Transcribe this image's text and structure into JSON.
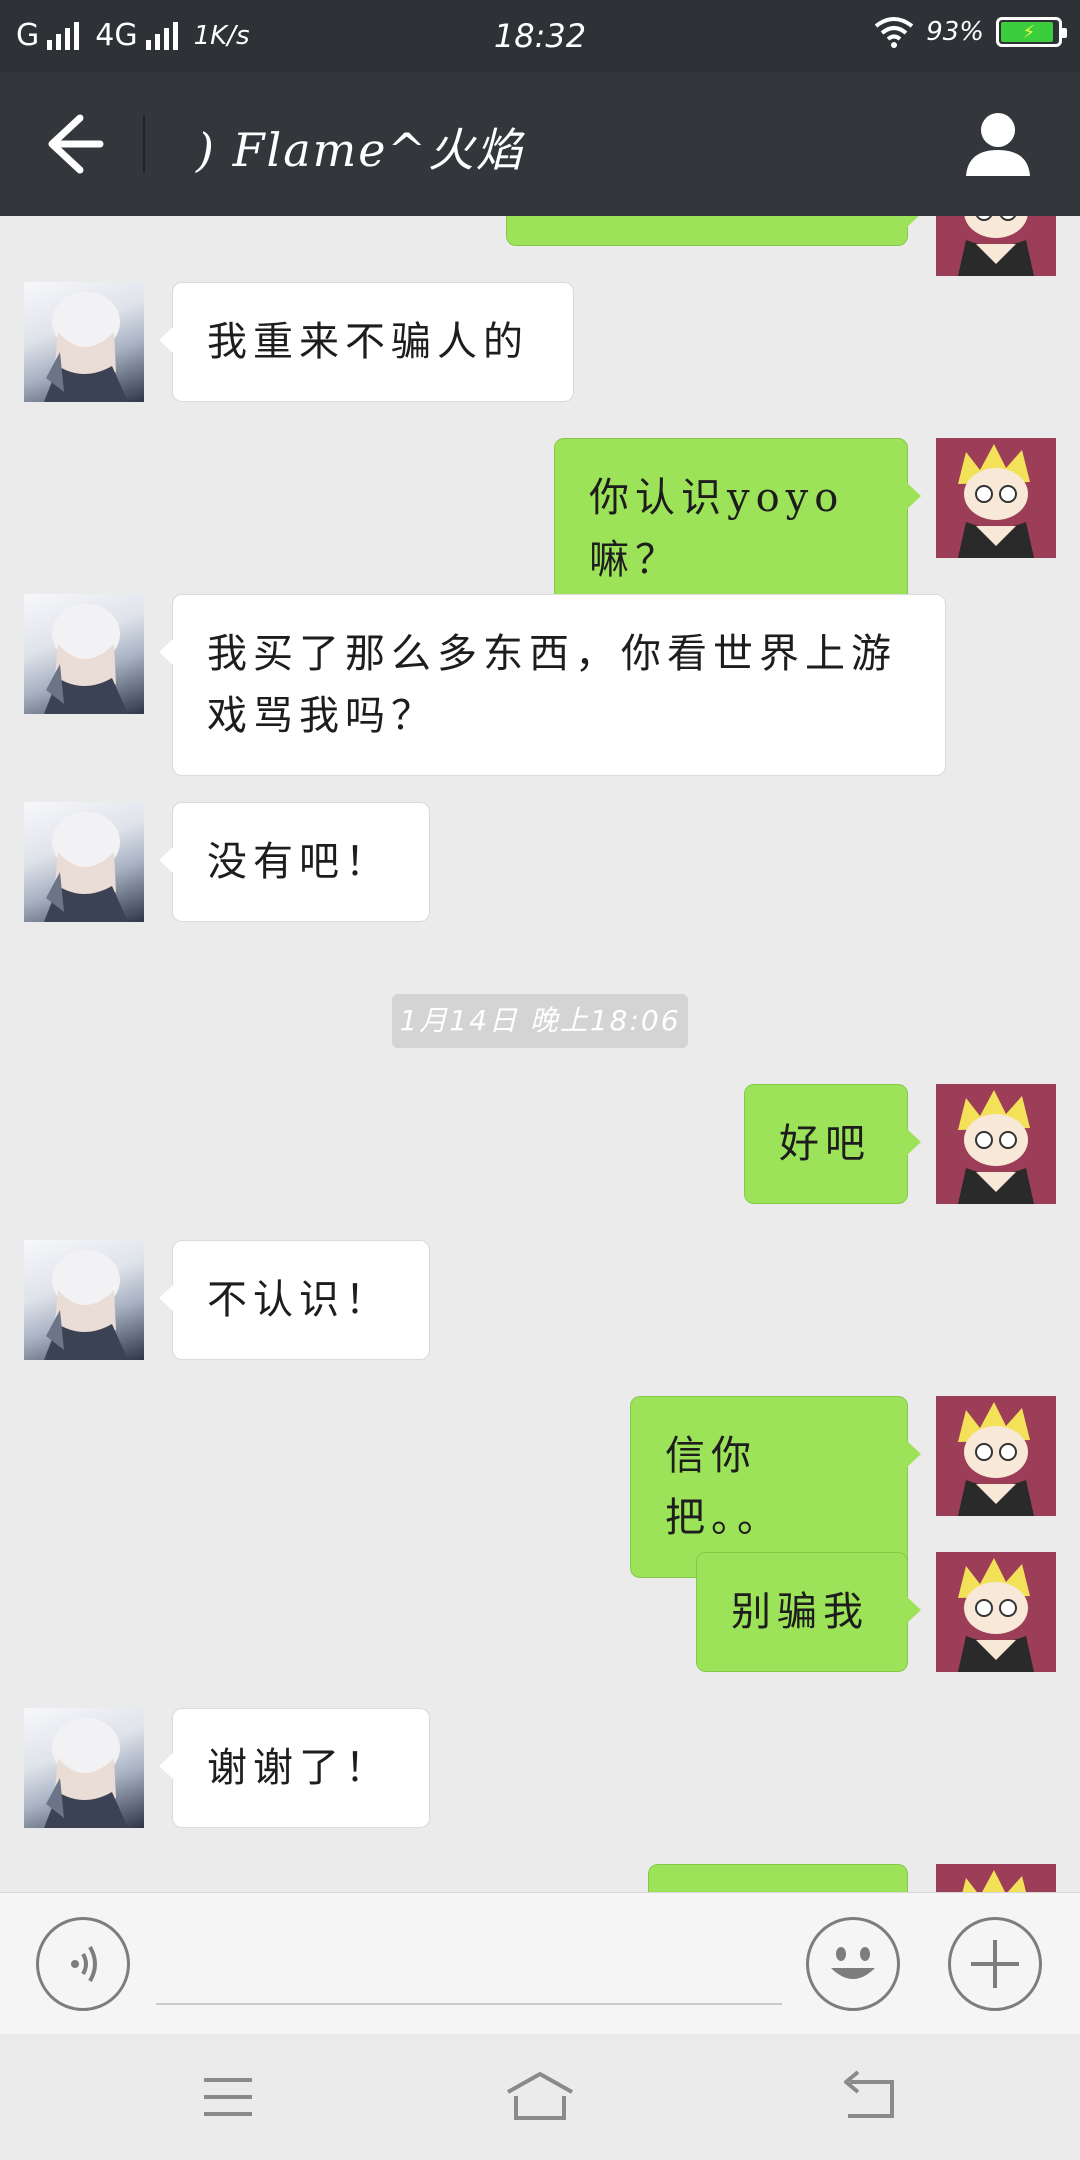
{
  "status_bar": {
    "carrier1": "G",
    "carrier2": "4G",
    "net_speed": "1K/s",
    "time": "18:32",
    "battery": "93%",
    "battery_level": 0.93
  },
  "header": {
    "title": ") Flame^火焰",
    "back_icon": "arrow-left-icon",
    "profile_icon": "person-icon"
  },
  "messages": [
    {
      "side": "right",
      "text": "",
      "partial": true
    },
    {
      "side": "left",
      "text": "我重来不骗人的"
    },
    {
      "side": "right",
      "text": "你认识yoyo嘛？"
    },
    {
      "side": "left",
      "text": "我买了那么多东西，你看世界上游戏骂我吗？"
    },
    {
      "side": "left",
      "text": "没有吧！"
    },
    {
      "side": "right",
      "text": "好吧"
    },
    {
      "side": "left",
      "text": "不认识！"
    },
    {
      "side": "right",
      "text": "信你把。。"
    },
    {
      "side": "right",
      "text": "别骗我"
    },
    {
      "side": "left",
      "text": "谢谢了！"
    },
    {
      "side": "right",
      "text": "",
      "partial": true
    }
  ],
  "timestamp": "1月14日 晚上18:06",
  "input_bar": {
    "placeholder": "",
    "voice_icon": "voice-icon",
    "emoji_icon": "emoji-icon",
    "plus_icon": "plus-icon"
  },
  "nav_bar": {
    "menu_icon": "menu-icon",
    "home_icon": "home-icon",
    "back_icon": "back-icon"
  },
  "colors": {
    "header_bg": "#33363b",
    "chat_bg": "#ebebeb",
    "self_bubble": "#9de359",
    "friend_bubble": "#ffffff",
    "self_avatar_bg": "#9c3e57"
  }
}
